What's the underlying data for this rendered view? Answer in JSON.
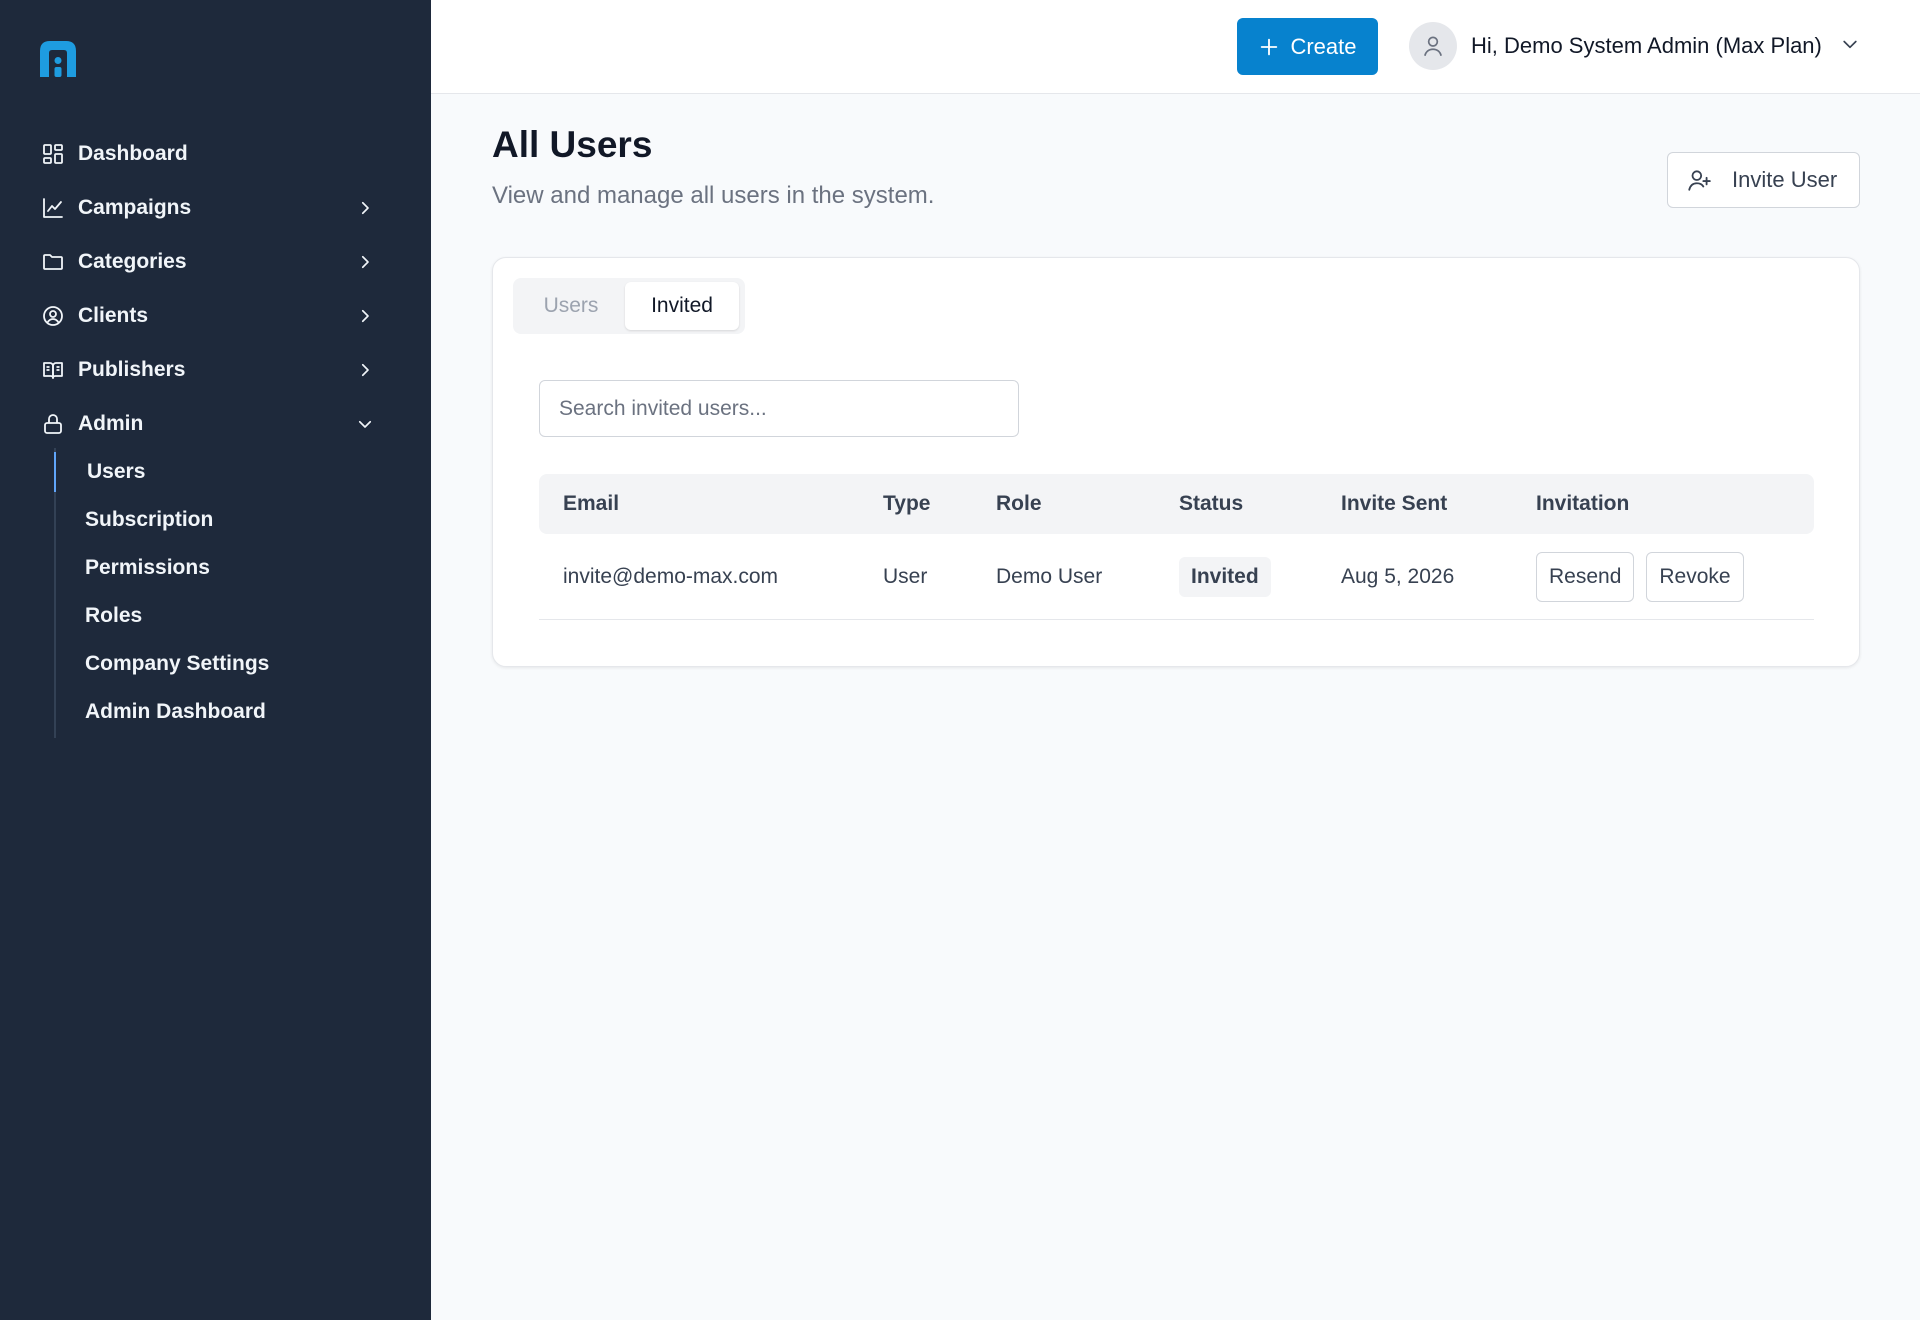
{
  "sidebar": {
    "items": [
      {
        "label": "Dashboard",
        "icon": "dashboard-grid-icon"
      },
      {
        "label": "Campaigns",
        "icon": "line-chart-icon"
      },
      {
        "label": "Categories",
        "icon": "folder-icon"
      },
      {
        "label": "Clients",
        "icon": "user-circle-icon"
      },
      {
        "label": "Publishers",
        "icon": "book-open-icon"
      },
      {
        "label": "Admin",
        "icon": "lock-icon"
      }
    ],
    "admin_subitems": [
      {
        "label": "Users"
      },
      {
        "label": "Subscription"
      },
      {
        "label": "Permissions"
      },
      {
        "label": "Roles"
      },
      {
        "label": "Company Settings"
      },
      {
        "label": "Admin Dashboard"
      }
    ]
  },
  "header": {
    "create_label": "Create",
    "user_greeting": "Hi, Demo System Admin (Max Plan)"
  },
  "page": {
    "title": "All Users",
    "subtitle": "View and manage all users in the system.",
    "invite_label": "Invite User"
  },
  "tabs": {
    "users": "Users",
    "invited": "Invited"
  },
  "search": {
    "placeholder": "Search invited users...",
    "value": ""
  },
  "table": {
    "headers": {
      "email": "Email",
      "type": "Type",
      "role": "Role",
      "status": "Status",
      "invite_sent": "Invite Sent",
      "invitation": "Invitation"
    },
    "rows": [
      {
        "email": "invite@demo-max.com",
        "type": "User",
        "role": "Demo User",
        "status": "Invited",
        "invite_sent": "Aug 5, 2026",
        "resend": "Resend",
        "revoke": "Revoke"
      }
    ]
  },
  "colors": {
    "sidebar_bg": "#1e293b",
    "primary": "#0782ce",
    "logo": "#1e9ce0"
  }
}
